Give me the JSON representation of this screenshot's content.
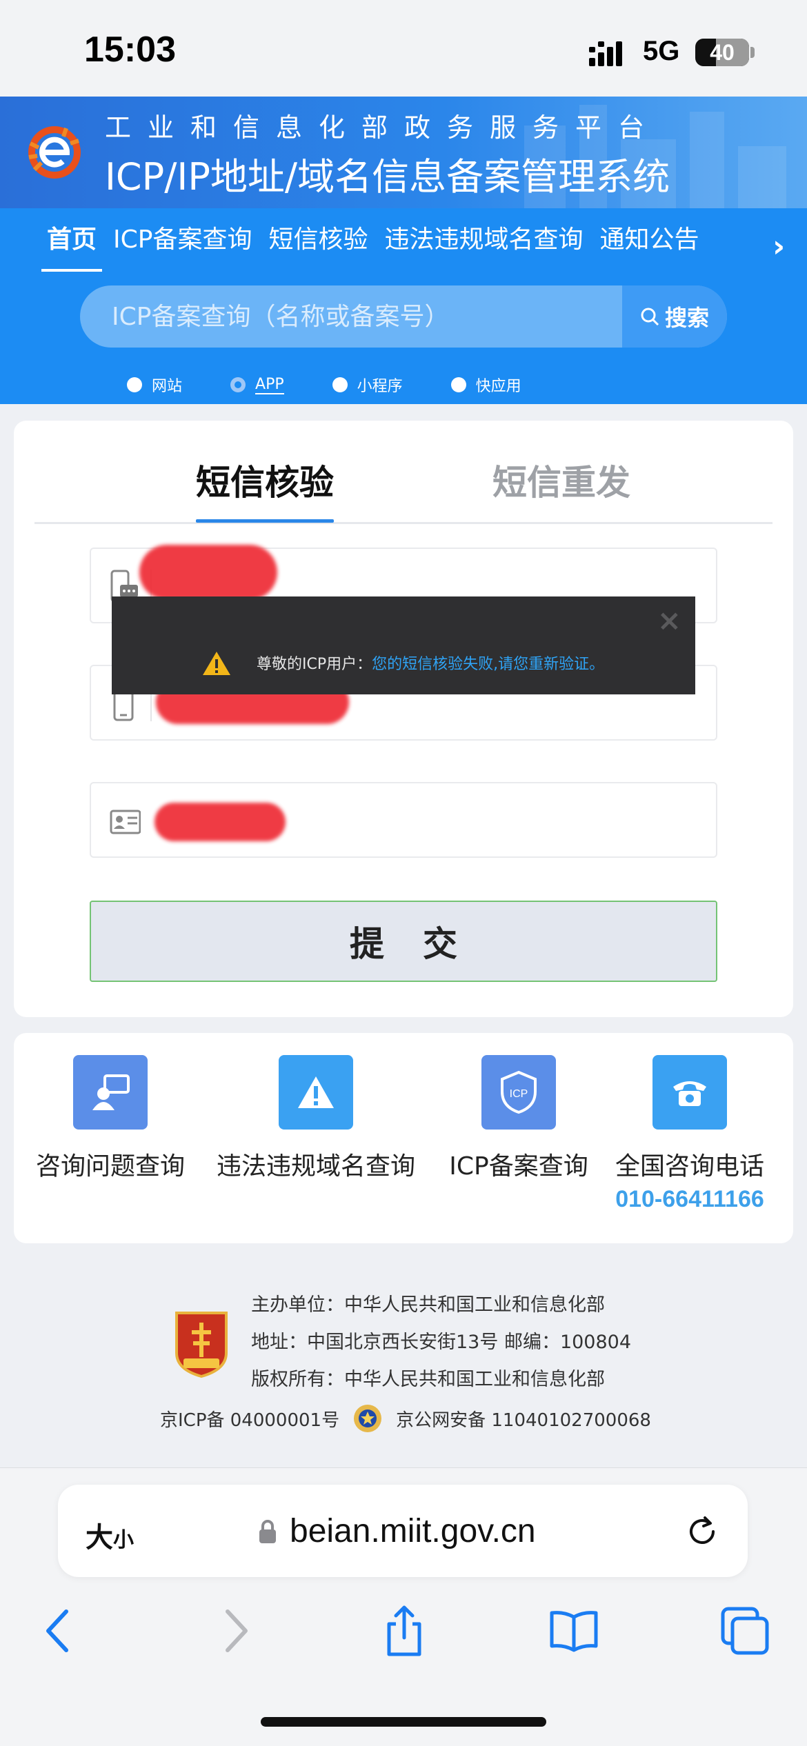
{
  "status": {
    "time": "15:03",
    "network": "5G",
    "battery": "40"
  },
  "site": {
    "subtitle": "工业和信息化部政务服务平台",
    "title": "ICP/IP地址/域名信息备案管理系统"
  },
  "nav": {
    "tabs": [
      "首页",
      "ICP备案查询",
      "短信核验",
      "违法违规域名查询",
      "通知公告"
    ],
    "more": "›"
  },
  "search": {
    "placeholder": "ICP备案查询（名称或备案号）",
    "button": "搜索",
    "types": [
      "网站",
      "APP",
      "小程序",
      "快应用"
    ],
    "selected_type": "APP"
  },
  "form": {
    "tabs": [
      "短信核验",
      "短信重发"
    ],
    "active_tab": "短信核验",
    "submit": "提交"
  },
  "toast": {
    "prefix": "尊敬的ICP用户：",
    "message": "您的短信核验失败,请您重新验证。",
    "close": "×"
  },
  "services": [
    {
      "label": "咨询问题查询",
      "icon": "consult-icon",
      "color": "#5b8ee8"
    },
    {
      "label": "违法违规域名查询",
      "icon": "warning-icon",
      "color": "#3aa1f2"
    },
    {
      "label": "ICP备案查询",
      "icon": "shield-icon",
      "color": "#5b8ee8"
    },
    {
      "label": "全国咨询电话",
      "icon": "phone-icon",
      "color": "#3aa1f2",
      "phone": "010-66411166"
    }
  ],
  "footer": {
    "sponsor": "主办单位：中华人民共和国工业和信息化部",
    "address": "地址：中国北京西长安街13号 邮编：100804",
    "copyright": "版权所有：中华人民共和国工业和信息化部",
    "icp": "京ICP备 04000001号",
    "police": "京公网安备 11040102700068"
  },
  "browser": {
    "text_size": "大",
    "text_size_small": "小",
    "url": "beian.miit.gov.cn"
  }
}
